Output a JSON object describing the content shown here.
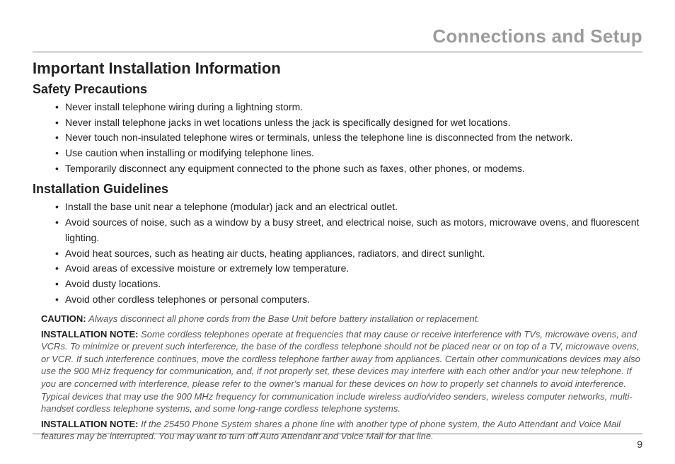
{
  "chapter": "Connections and Setup",
  "section_title": "Important Installation Information",
  "safety": {
    "heading": "Safety Precautions",
    "items": [
      "Never install telephone wiring during a lightning storm.",
      "Never install telephone jacks in wet locations unless the jack is specifically designed for wet locations.",
      "Never touch non-insulated telephone wires or terminals, unless the telephone line is disconnected from the network.",
      "Use caution when installing or modifying telephone lines.",
      "Temporarily disconnect any equipment connected to the phone such as faxes, other phones, or modems."
    ]
  },
  "guidelines": {
    "heading": "Installation Guidelines",
    "items": [
      "Install the base unit near a telephone (modular) jack and an electrical outlet.",
      "Avoid sources of noise, such as a window by a busy street, and electrical noise, such as motors, microwave ovens, and fluorescent lighting.",
      "Avoid heat sources, such as heating air ducts, heating appliances, radiators, and direct sunlight.",
      "Avoid areas of excessive moisture or extremely low temperature.",
      "Avoid dusty locations.",
      "Avoid other cordless telephones or personal computers."
    ]
  },
  "notes": {
    "caution_lead": "CAUTION:",
    "caution_body": "Always disconnect all phone cords from the Base Unit before battery installation or replacement.",
    "note1_lead": "INSTALLATION NOTE:",
    "note1_body": "Some cordless telephones operate at frequencies that may cause or receive interference with TVs, microwave ovens, and VCRs. To minimize or prevent such interference, the base of the cordless telephone should not be placed near or on top of a TV, microwave ovens, or VCR. If such interference continues, move the cordless telephone farther away from appliances. Certain other communications devices may also use the 900 MHz frequency for communication, and, if not properly set, these devices may interfere with each other and/or your new telephone. If you are concerned with interference, please refer to the owner's manual for these devices on how to properly set channels to avoid interference. Typical devices that may use the 900 MHz frequency for communication include wireless audio/video senders, wireless computer networks, multi-handset cordless telephone systems, and some long-range cordless telephone systems.",
    "note2_lead": "INSTALLATION NOTE:",
    "note2_body": "If the 25450 Phone System shares a phone line with another type of phone system, the Auto Attendant and Voice Mail features may be interrupted. You may want to turn off Auto Attendant and Voice Mail for that line."
  },
  "page_number": "9"
}
